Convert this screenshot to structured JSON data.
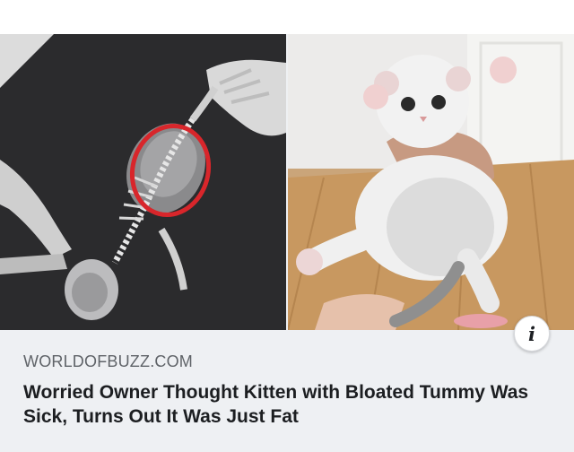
{
  "card": {
    "domain": "WORLDOFBUZZ.COM",
    "headline": "Worried Owner Thought Kitten with Bloated Tummy Was Sick, Turns Out It Was Just Fat",
    "info_icon": "info-icon",
    "images": [
      {
        "name": "kitten-xray-image"
      },
      {
        "name": "kitten-photo-image"
      }
    ]
  },
  "colors": {
    "card_background": "#eef0f3",
    "annotation_circle": "#d8262b",
    "domain_text": "#5f6368",
    "headline_text": "#1c1e21"
  }
}
